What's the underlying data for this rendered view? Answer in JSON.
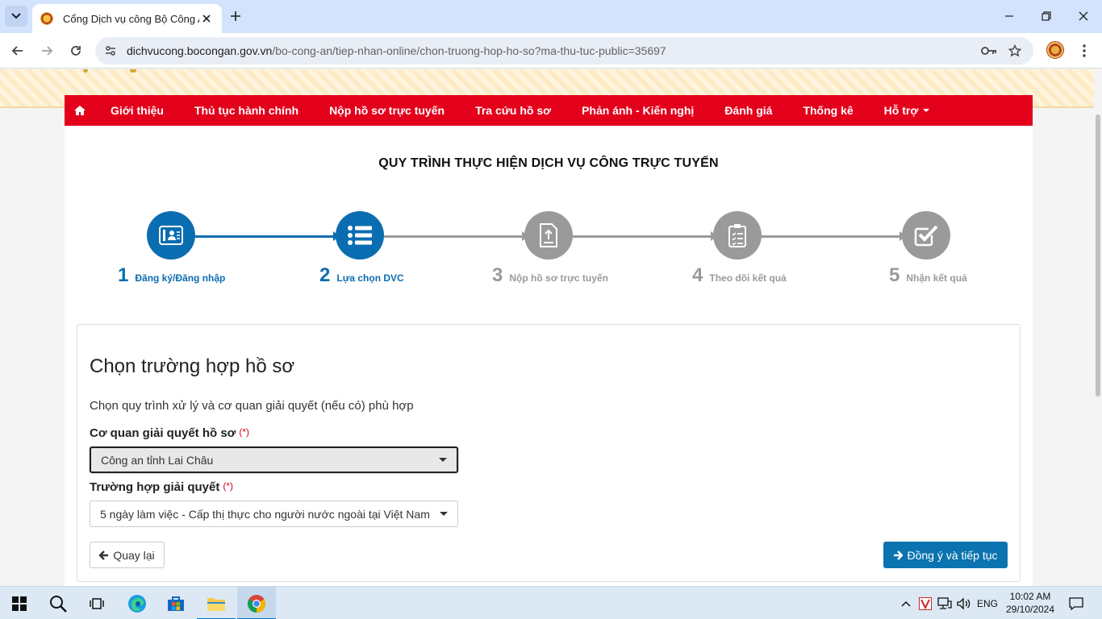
{
  "browser": {
    "tab_title": "Cổng Dịch vụ công Bộ Công An",
    "url_host": "dichvucong.bocongan.gov.vn",
    "url_path": "/bo-cong-an/tiep-nhan-online/chon-truong-hop-ho-so?ma-thu-tuc-public=35697"
  },
  "nav": {
    "items": [
      {
        "label": "Giới thiệu"
      },
      {
        "label": "Thủ tục hành chính"
      },
      {
        "label": "Nộp hồ sơ trực tuyến"
      },
      {
        "label": "Tra cứu hồ sơ"
      },
      {
        "label": "Phản ánh - Kiến nghị"
      },
      {
        "label": "Đánh giá"
      },
      {
        "label": "Thống kê"
      },
      {
        "label": "Hỗ trợ"
      }
    ],
    "color": "#e3001b"
  },
  "process": {
    "title": "QUY TRÌNH THỰC HIỆN DỊCH VỤ CÔNG TRỰC TUYẾN",
    "active_color": "#0b6db1",
    "inactive_color": "#9a9a9a",
    "steps": [
      {
        "num": "1",
        "label": "Đăng ký/Đăng nhập",
        "icon": "id-card-icon",
        "active": true
      },
      {
        "num": "2",
        "label": "Lựa chọn DVC",
        "icon": "list-icon",
        "active": true
      },
      {
        "num": "3",
        "label": "Nộp hồ sơ trực tuyến",
        "icon": "upload-document-icon",
        "active": false
      },
      {
        "num": "4",
        "label": "Theo dõi kết quả",
        "icon": "clipboard-icon",
        "active": false
      },
      {
        "num": "5",
        "label": "Nhận kết quả",
        "icon": "check-square-icon",
        "active": false
      }
    ]
  },
  "form": {
    "title": "Chọn trường hợp hồ sơ",
    "description": "Chọn quy trình xử lý và cơ quan giải quyết (nếu có) phù hợp",
    "agency_label": "Cơ quan giải quyết hồ sơ",
    "agency_value": "Công an tỉnh Lai Châu",
    "case_label": "Trường hợp giải quyết",
    "case_value": "5 ngày làm việc - Cấp thị thực cho người nước ngoài tại Việt Nam",
    "required_mark": "(*)",
    "back_label": "Quay lại",
    "next_label": "Đồng ý và tiếp tục",
    "next_color": "#0b74b0"
  },
  "taskbar": {
    "language": "ENG",
    "time": "10:02 AM",
    "date": "29/10/2024"
  }
}
